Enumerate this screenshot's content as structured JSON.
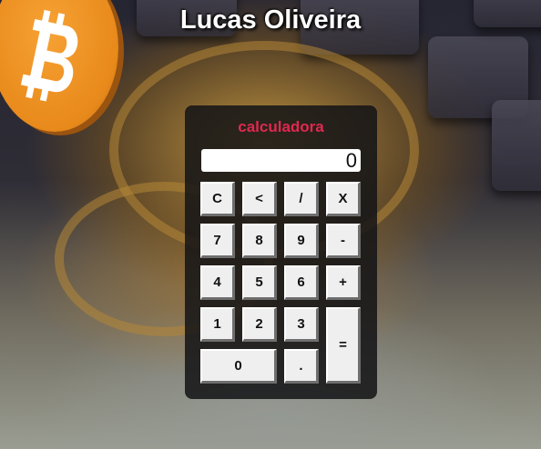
{
  "header": {
    "title": "Lucas Oliveira"
  },
  "calculator": {
    "title": "calculadora",
    "display_value": "0",
    "buttons": {
      "clear": "C",
      "backspace": "<",
      "divide": "/",
      "multiply": "X",
      "seven": "7",
      "eight": "8",
      "nine": "9",
      "minus": "-",
      "four": "4",
      "five": "5",
      "six": "6",
      "plus": "+",
      "one": "1",
      "two": "2",
      "three": "3",
      "equals": "=",
      "zero": "0",
      "decimal": "."
    }
  },
  "colors": {
    "calc_title": "#e0284f",
    "bitcoin_orange": "#f7931a"
  },
  "icons": {
    "logo": "bitcoin-icon"
  }
}
